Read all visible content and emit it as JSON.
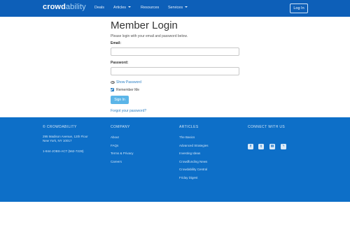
{
  "navbar": {
    "brand_main": "crowd",
    "brand_light": "ability",
    "items": [
      {
        "label": "Deals"
      },
      {
        "label": "Articles"
      },
      {
        "label": "Resources"
      },
      {
        "label": "Services"
      }
    ],
    "login_label": "Log In"
  },
  "login": {
    "title": "Member Login",
    "instructions": "Please login with your email and password below.",
    "email_label": "Email:",
    "email_value": "",
    "password_label": "Password:",
    "password_value": "",
    "show_password": "Show Password",
    "remember_me": "Remember Me",
    "remember_checked": true,
    "signin_label": "Sign In",
    "forgot": "Forgot your password?"
  },
  "footer": {
    "col1": {
      "heading": "© CROWDABILITY",
      "address1": "295 Madison Avenue, 12th Floor",
      "address2": "New York, NY 10017",
      "phone": "1-844-JOBS-ACT (562-7228)"
    },
    "col2": {
      "heading": "COMPANY",
      "links": [
        "About",
        "FAQs",
        "Terms & Privacy",
        "Careers"
      ]
    },
    "col3": {
      "heading": "ARTICLES",
      "links": [
        "The Basics",
        "Advanced Strategies",
        "Investing Ideas",
        "Crowdfunding News",
        "Crowdability Central",
        "Friday Digest"
      ]
    },
    "col4": {
      "heading": "CONNECT WITH US",
      "icons": [
        "facebook-icon",
        "twitter-icon",
        "email-icon",
        "rss-icon"
      ]
    }
  },
  "colors": {
    "nav_bg": "#0d5fb8",
    "footer_bg": "#0d6fc8",
    "link": "#2a7fc4",
    "button": "#5bb5e8"
  }
}
